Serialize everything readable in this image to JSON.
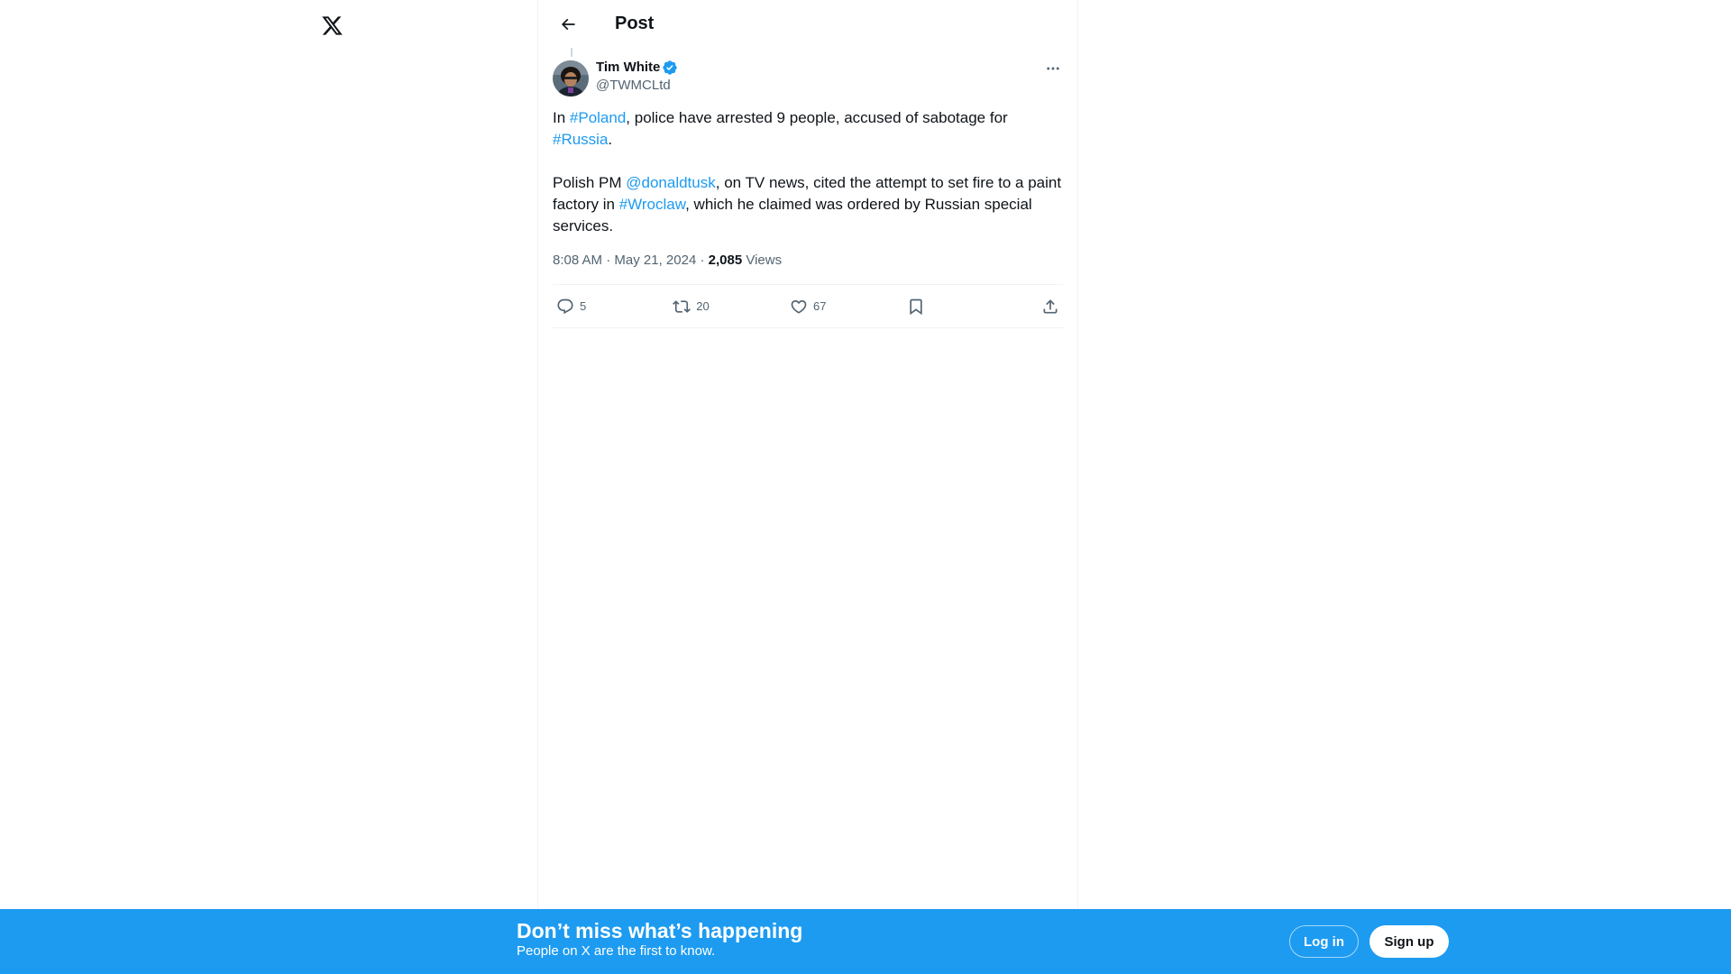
{
  "header": {
    "title": "Post"
  },
  "post": {
    "author_name": "Tim White",
    "author_handle": "@TWMCLtd",
    "text": {
      "p1_prefix": "In ",
      "p1_hashtag1": "#Poland",
      "p1_middle": ", police have arrested 9 people, accused of sabotage for ",
      "p1_hashtag2": "#Russia",
      "p1_suffix": ".",
      "p2_prefix": "Polish PM ",
      "p2_mention": "@donaldtusk",
      "p2_middle": ", on TV news, cited the attempt to set fire to a paint factory in ",
      "p2_hashtag": "#Wroclaw",
      "p2_suffix": ", which he claimed was ordered by Russian special services."
    },
    "time": "8:08 AM",
    "date": "May 21, 2024",
    "separator": " · ",
    "views_count": "2,085",
    "views_label": " Views",
    "replies": "5",
    "reposts": "20",
    "likes": "67"
  },
  "banner": {
    "title": "Don’t miss what’s happening",
    "subtitle": "People on X are the first to know.",
    "login_label": "Log in",
    "signup_label": "Sign up"
  },
  "icons": {
    "logo": "x-logo-icon",
    "back": "arrow-left-icon",
    "verified": "verified-badge-icon",
    "more": "more-horizontal-icon",
    "reply": "reply-icon",
    "repost": "repost-icon",
    "like": "heart-icon",
    "bookmark": "bookmark-icon",
    "share": "share-icon"
  },
  "colors": {
    "accent": "#1d9bf0",
    "text": "#0f1419",
    "secondary": "#536471"
  }
}
